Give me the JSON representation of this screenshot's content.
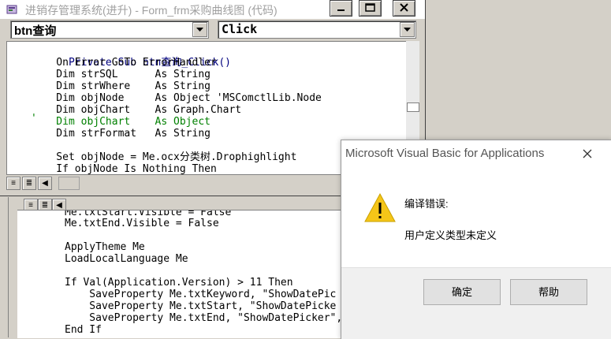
{
  "window": {
    "title": "进销存管理系统(进升) - Form_frm采购曲线图 (代码)"
  },
  "object_combo": {
    "value": "btn查询"
  },
  "procedure_combo": {
    "value": "Click"
  },
  "code_lines": [
    "Private Sub btn查询_Click()",
    "    On Error GoTo ErrorHandler",
    "    Dim strSQL      As String",
    "    Dim strWhere    As String",
    "    Dim objNode     As Object 'MSComctlLib.Node",
    "    Dim objChart    As Graph.Chart",
    "    Dim objChart    As Object",
    "    Dim strFormat   As String",
    "",
    "    Set objNode = Me.ocx分类树.Drophighlight",
    "    If objNode Is Nothing Then"
  ],
  "comment_marker": "'",
  "bg_code_lines": [
    "Me.txtStart.Visible = False",
    "Me.txtEnd.Visible = False",
    "",
    "ApplyTheme Me",
    "LoadLocalLanguage Me",
    "",
    "If Val(Application.Version) > 11 Then",
    "    SaveProperty Me.txtKeyword, \"ShowDatePic",
    "    SaveProperty Me.txtStart, \"ShowDatePicke",
    "    SaveProperty Me.txtEnd, \"ShowDatePicker\", dbBoolean, False",
    "End If"
  ],
  "dialog": {
    "title": "Microsoft Visual Basic for Applications",
    "heading": "编译错误:",
    "message": "用户定义类型未定义",
    "ok_label": "确定",
    "help_label": "帮助"
  },
  "colors": {
    "keyword": "#00007f",
    "comment": "#008000",
    "title_inactive": "#a0a0a0"
  }
}
